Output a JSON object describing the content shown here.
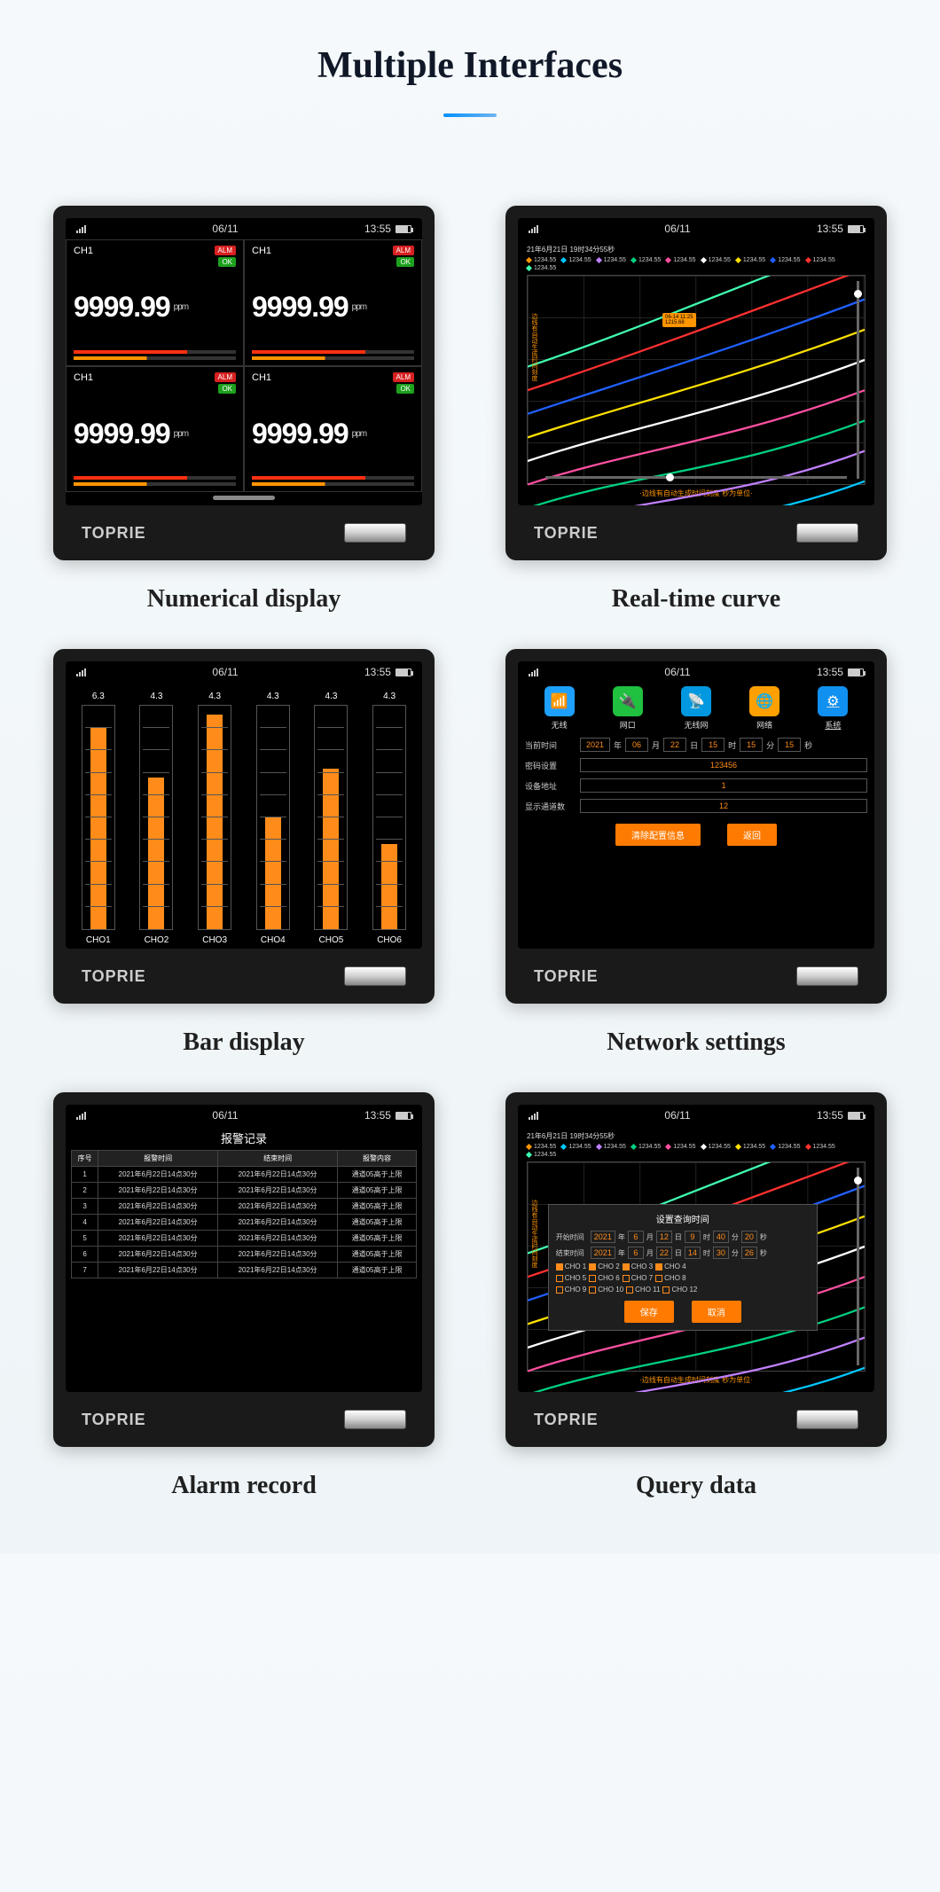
{
  "page_title": "Multiple Interfaces",
  "brand": "TOPRIE",
  "status": {
    "date": "06/11",
    "time": "13:55"
  },
  "captions": {
    "numerical": "Numerical display",
    "curve": "Real-time curve",
    "bar": "Bar display",
    "network": "Network settings",
    "alarm": "Alarm record",
    "query": "Query data"
  },
  "numerical": {
    "channels": [
      {
        "name": "CH1",
        "value": "9999.99",
        "unit": "ppm",
        "alm": "ALM",
        "ok": "OK"
      },
      {
        "name": "CH1",
        "value": "9999.99",
        "unit": "ppm",
        "alm": "ALM",
        "ok": "OK"
      },
      {
        "name": "CH1",
        "value": "9999.99",
        "unit": "ppm",
        "alm": "ALM",
        "ok": "OK"
      },
      {
        "name": "CH1",
        "value": "9999.99",
        "unit": "ppm",
        "alm": "ALM",
        "ok": "OK"
      }
    ]
  },
  "curve": {
    "timestamp": "21年6月21日 19时34分55秒",
    "legend_value": "1234.55",
    "legend_colors": [
      "#ff9500",
      "#00c8ff",
      "#c080ff",
      "#00d080",
      "#ff50a0",
      "#ffffff",
      "#ffe000",
      "#2060ff",
      "#ff3030",
      "#40ffb0"
    ],
    "tag_line1": "06-14 11:25",
    "tag_line2": "1215.68",
    "ylabel": "边线有自动生成时间刻度",
    "footer": "·边线有自动生成时间刻度 秒为单位·"
  },
  "bar": {
    "channels": [
      {
        "label": "CHO1",
        "value": "6.3",
        "pct": 90
      },
      {
        "label": "CHO2",
        "value": "4.3",
        "pct": 68
      },
      {
        "label": "CHO3",
        "value": "4.3",
        "pct": 96
      },
      {
        "label": "CHO4",
        "value": "4.3",
        "pct": 50
      },
      {
        "label": "CHO5",
        "value": "4.3",
        "pct": 72
      },
      {
        "label": "CHO6",
        "value": "4.3",
        "pct": 38
      }
    ]
  },
  "network": {
    "tabs": [
      {
        "label": "无线",
        "color": "#1ea0ff",
        "glyph": "📶"
      },
      {
        "label": "网口",
        "color": "#20c040",
        "glyph": "🔌"
      },
      {
        "label": "无线网",
        "color": "#0098e0",
        "glyph": "📡"
      },
      {
        "label": "网络",
        "color": "#ffa000",
        "glyph": "🌐"
      },
      {
        "label": "系统",
        "color": "#1090f0",
        "glyph": "⚙",
        "active": true
      }
    ],
    "time_label": "当前时间",
    "time": {
      "year": "2021",
      "y": "年",
      "month": "06",
      "mo": "月",
      "day": "22",
      "d": "日",
      "hour": "15",
      "h": "时",
      "min": "15",
      "mi": "分",
      "sec": "15",
      "s": "秒"
    },
    "password_label": "密码设置",
    "password": "123456",
    "addr_label": "设备地址",
    "addr": "1",
    "chan_label": "显示通道数",
    "chan": "12",
    "btn_clear": "清除配置信息",
    "btn_back": "返回"
  },
  "alarm": {
    "title": "报警记录",
    "headers": [
      "序号",
      "报警时间",
      "结束时间",
      "报警内容"
    ],
    "rows": [
      [
        "1",
        "2021年6月22日14点30分",
        "2021年6月22日14点30分",
        "通道05高于上限"
      ],
      [
        "2",
        "2021年6月22日14点30分",
        "2021年6月22日14点30分",
        "通道05高于上限"
      ],
      [
        "3",
        "2021年6月22日14点30分",
        "2021年6月22日14点30分",
        "通道05高于上限"
      ],
      [
        "4",
        "2021年6月22日14点30分",
        "2021年6月22日14点30分",
        "通道05高于上限"
      ],
      [
        "5",
        "2021年6月22日14点30分",
        "2021年6月22日14点30分",
        "通道05高于上限"
      ],
      [
        "6",
        "2021年6月22日14点30分",
        "2021年6月22日14点30分",
        "通道05高于上限"
      ],
      [
        "7",
        "2021年6月22日14点30分",
        "2021年6月22日14点30分",
        "通道05高于上限"
      ]
    ]
  },
  "query": {
    "title": "设置查询时间",
    "start_label": "开始时间",
    "end_label": "结束时间",
    "start": [
      "2021",
      "年",
      "6",
      "月",
      "12",
      "日",
      "9",
      "时",
      "40",
      "分",
      "20",
      "秒"
    ],
    "end": [
      "2021",
      "年",
      "6",
      "月",
      "22",
      "日",
      "14",
      "时",
      "30",
      "分",
      "26",
      "秒"
    ],
    "channels": [
      "CHO 1",
      "CHO 2",
      "CHO 3",
      "CHO 4",
      "CHO 5",
      "CHO 6",
      "CHO 7",
      "CHO 8",
      "CHO 9",
      "CHO 10",
      "CHO 11",
      "CHO 12"
    ],
    "btn_save": "保存",
    "btn_cancel": "取消"
  }
}
